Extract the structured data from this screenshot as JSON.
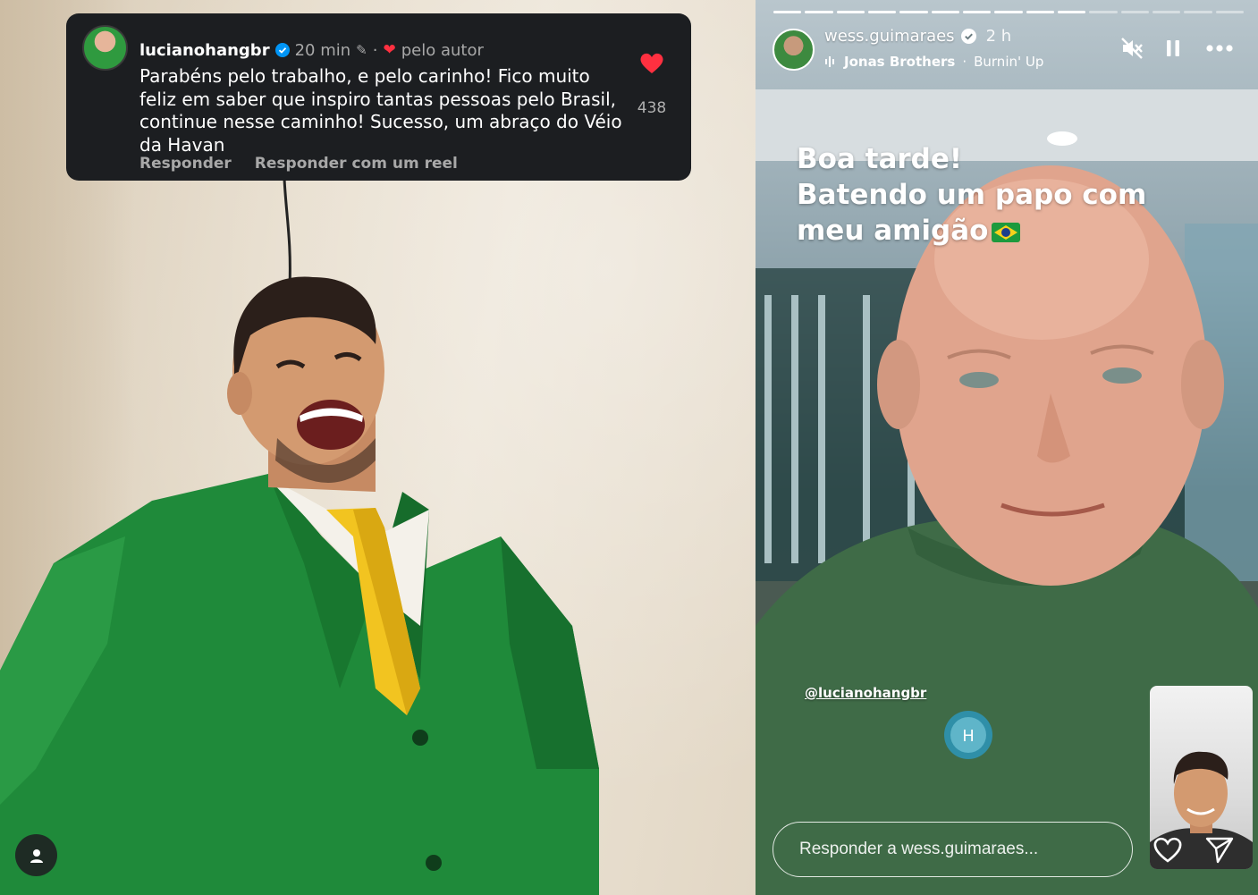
{
  "comment": {
    "username": "lucianohangbr",
    "time": "20 min",
    "separator": "·",
    "liked_by_author": "pelo autor",
    "text": "Parabéns pelo trabalho, e pelo carinho! Fico muito feliz em saber que inspiro tantas pessoas pelo Brasil, continue nesse caminho! Sucesso, um abraço do Véio da Havan",
    "likes": "438",
    "actions": {
      "reply": "Responder",
      "reply_with_reel": "Responder com um reel"
    }
  },
  "story": {
    "username": "wess.guimaraes",
    "time": "2 h",
    "music": {
      "artist": "Jonas Brothers",
      "separator": "·",
      "track": "Burnin' Up"
    },
    "progress": {
      "total_segments": 15,
      "completed_segments": 10
    },
    "caption_lines": [
      "Boa tarde!",
      "Batendo um papo com",
      "meu amigão"
    ],
    "mention": "@lucianohangbr",
    "reply_placeholder": "Responder a wess.guimaraes..."
  },
  "icons": {
    "verified": "verified-badge-icon",
    "pin": "pin-icon",
    "heart": "heart-icon",
    "profile": "person-icon",
    "music": "music-bars-icon",
    "mute": "speaker-muted-icon",
    "pause": "pause-icon",
    "more": "more-horizontal-icon",
    "flag": "brazil-flag-icon",
    "share": "send-icon"
  },
  "colors": {
    "comment_card_bg": "#1c1e21",
    "heart_red": "#ff3040",
    "verified_blue": "#0095f6",
    "muted_text": "#a8a8a8",
    "suit_green": "#1f8a3a",
    "tie_yellow": "#f2c420"
  }
}
